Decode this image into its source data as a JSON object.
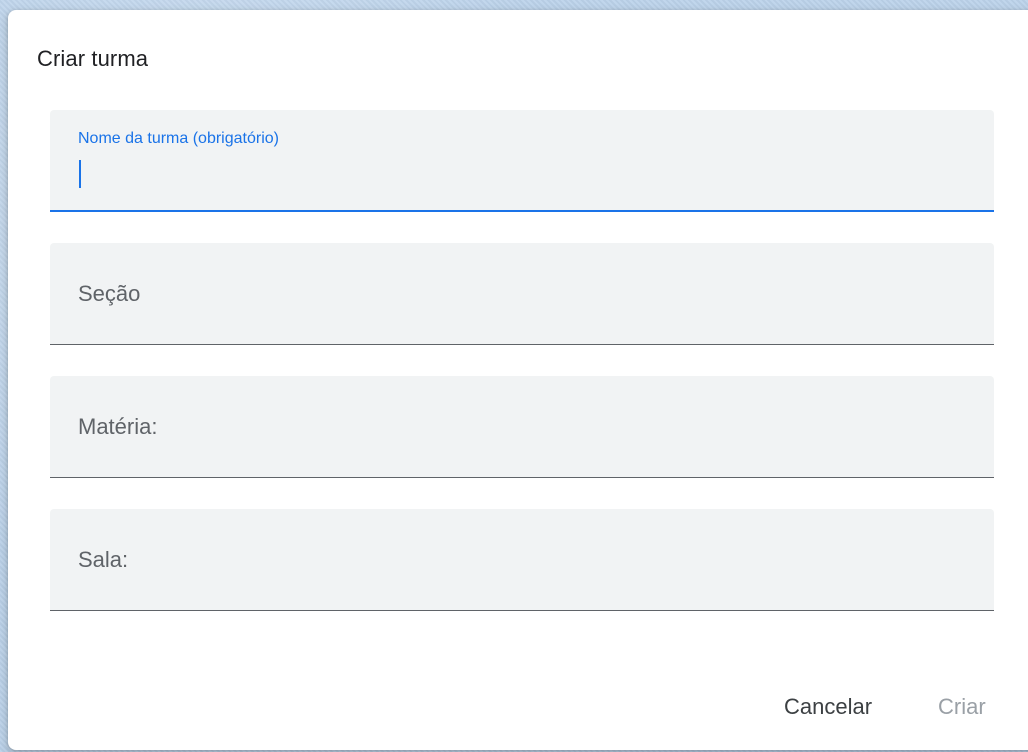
{
  "dialog": {
    "title": "Criar turma"
  },
  "fields": [
    {
      "label": "Nome da turma (obrigatório)",
      "value": "",
      "focused": true
    },
    {
      "label": "Seção",
      "value": ""
    },
    {
      "label": "Matéria:",
      "value": ""
    },
    {
      "label": "Sala:",
      "value": ""
    }
  ],
  "actions": {
    "cancel_label": "Cancelar",
    "create_label": "Criar",
    "create_disabled": true
  },
  "colors": {
    "accent": "#1a73e8",
    "field_background": "#f1f3f4",
    "disabled_text": "#9aa0a6",
    "label_text": "#5f6368"
  }
}
